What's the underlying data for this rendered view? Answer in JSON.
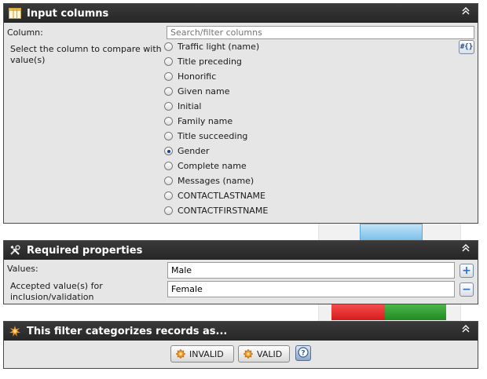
{
  "panels": {
    "input_columns": {
      "title": "Input columns",
      "column_label": "Column:",
      "search_placeholder": "Search/filter columns",
      "description": "Select the column to compare with value(s)",
      "variable_button_label": "#{}",
      "options": [
        {
          "label": "Traffic light (name)",
          "checked": false
        },
        {
          "label": "Title preceding",
          "checked": false
        },
        {
          "label": "Honorific",
          "checked": false
        },
        {
          "label": "Given name",
          "checked": false
        },
        {
          "label": "Initial",
          "checked": false
        },
        {
          "label": "Family name",
          "checked": false
        },
        {
          "label": "Title succeeding",
          "checked": false
        },
        {
          "label": "Gender",
          "checked": true
        },
        {
          "label": "Complete name",
          "checked": false
        },
        {
          "label": "Messages (name)",
          "checked": false
        },
        {
          "label": "CONTACTLASTNAME",
          "checked": false
        },
        {
          "label": "CONTACTFIRSTNAME",
          "checked": false
        }
      ]
    },
    "required_properties": {
      "title": "Required properties",
      "values_label": "Values:",
      "description": "Accepted value(s) for inclusion/validation",
      "values": [
        "Male",
        "Female"
      ]
    },
    "categorize": {
      "title": "This filter categorizes records as...",
      "invalid_label": "INVALID",
      "valid_label": "VALID"
    }
  },
  "colors": {
    "header_bg": "#2f2f2f",
    "panel_bg": "#e6e6e6",
    "checked_dot": "#1e3f8a"
  }
}
